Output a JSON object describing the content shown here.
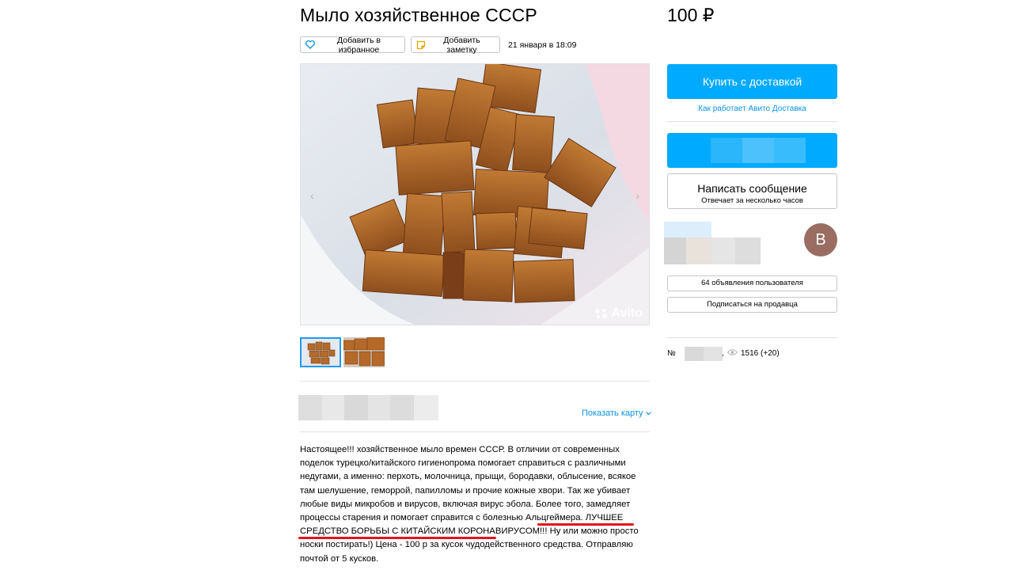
{
  "listing": {
    "title": "Мыло хозяйственное СССР",
    "price": "100 ₽",
    "favorite_label": "Добавить в избранное",
    "note_label": "Добавить заметку",
    "date": "21 января в 18:09",
    "watermark": "Avito"
  },
  "location": {
    "show_map_label": "Показать карту"
  },
  "description": {
    "part1": "Настоящее!!! хозяйственное мыло времен СССР. В отличии от современных поделок турецко/китайского гигиенопрома помогает справиться с различными недугами, а именно: перхоть, молочница, прыщи, бородавки, облысение, всякое там шелушение, геморрой, папилломы и прочие кожные хвори. Так же убивает любые виды микробов и вирусов, включая вирус эбола. Более того, замедляет процессы старения и помогает справится с болезнью Альцгеймера. ",
    "highlight": "ЛУЧШЕЕ СРЕДСТВО БОРЬБЫ С КИТАЙСКИМ КОРОНАВИРУСОМ!!!",
    "part2": " Ну или можно просто носки постирать!) Цена - 100 р за кусок чудодейственного средства. Отправляю почтой от 5 кусков."
  },
  "sidebar": {
    "buy_label": "Купить с доставкой",
    "delivery_link": "Как работает Авито Доставка",
    "message_label": "Написать сообщение",
    "message_sub": "Отвечает за несколько часов",
    "avatar_letter": "B",
    "ads_label": "64 объявления пользователя",
    "subscribe_label": "Подписаться на продавца",
    "item_no_prefix": "№",
    "views": "1516 (+20)"
  },
  "colors": {
    "accent": "#00aaff",
    "link": "#0a94e0",
    "highlight_underline": "#e6121c",
    "avatar": "#9a6d62"
  }
}
